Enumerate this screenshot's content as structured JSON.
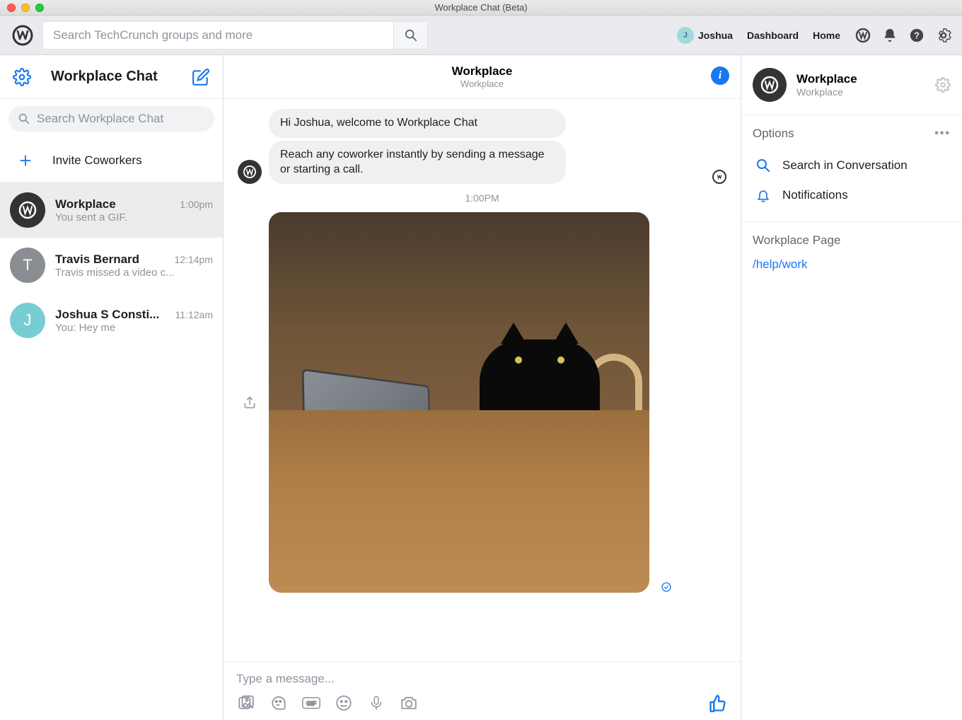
{
  "window": {
    "title": "Workplace Chat (Beta)"
  },
  "topbar": {
    "search_placeholder": "Search TechCrunch groups and more",
    "user_name": "Joshua",
    "user_initial": "J",
    "links": {
      "dashboard": "Dashboard",
      "home": "Home"
    }
  },
  "sidebar": {
    "title": "Workplace Chat",
    "search_placeholder": "Search Workplace Chat",
    "invite_label": "Invite Coworkers",
    "items": [
      {
        "name": "Workplace",
        "time": "1:00pm",
        "sub": "You sent a GIF.",
        "initial": "W",
        "avclass": "wp",
        "active": true
      },
      {
        "name": "Travis Bernard",
        "time": "12:14pm",
        "sub": "Travis missed a video c...",
        "initial": "T",
        "avclass": "tb",
        "active": false
      },
      {
        "name": "Joshua S Consti...",
        "time": "11:12am",
        "sub": "You: Hey me",
        "initial": "J",
        "avclass": "jc",
        "active": false
      }
    ]
  },
  "chat": {
    "title": "Workplace",
    "subtitle": "Workplace",
    "messages": {
      "intro1": "Hi Joshua, welcome to Workplace Chat",
      "intro2": "Reach any coworker instantly by sending a message or starting a call.",
      "timestamp": "1:00PM"
    },
    "composer_placeholder": "Type a message..."
  },
  "rightpanel": {
    "name": "Workplace",
    "sub": "Workplace",
    "options_title": "Options",
    "search_label": "Search in Conversation",
    "notifications_label": "Notifications",
    "page_title": "Workplace Page",
    "page_link": "/help/work"
  }
}
